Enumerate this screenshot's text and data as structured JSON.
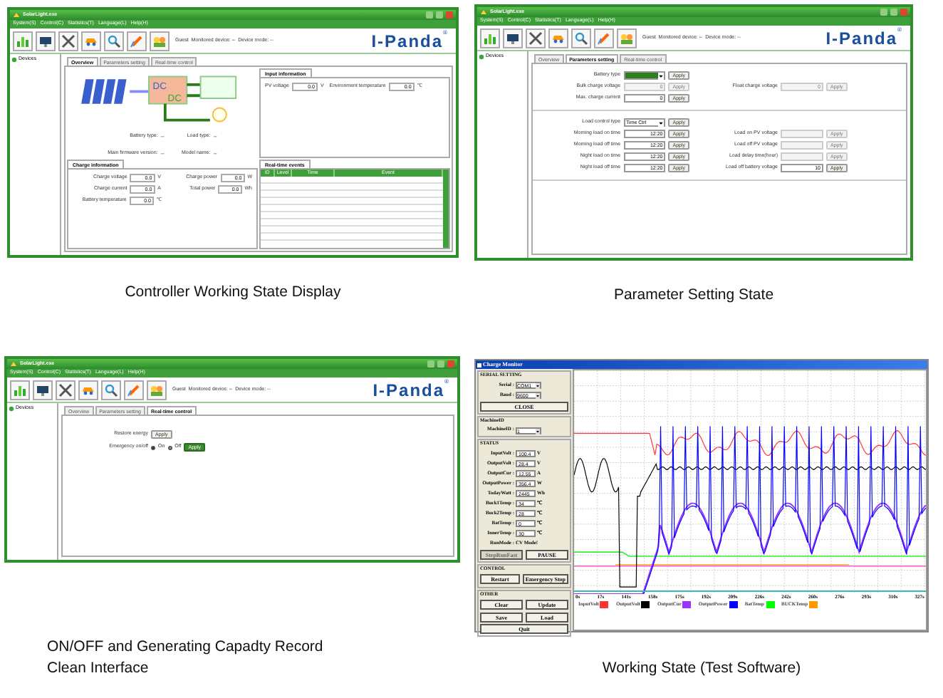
{
  "windows": [
    {
      "kind": "overview",
      "title": "SolarLight.exe",
      "menu": [
        "System(S)",
        "Control(C)",
        "Statistics(T)",
        "Language(L)",
        "Help(H)"
      ],
      "status": "Guest  Monitored device: --  Device mode: --",
      "logo": "I-Panda",
      "logo_mark": "®",
      "tree_item": "Devices",
      "tabs": [
        {
          "label": "Overview",
          "selected": true
        },
        {
          "label": "Parameters setting",
          "selected": false
        },
        {
          "label": "Real-time control",
          "selected": false
        }
      ],
      "diagram_labels": [
        "DC",
        "DC"
      ],
      "info": [
        {
          "label": "Battery type:",
          "value": "--"
        },
        {
          "label": "Load type:",
          "value": "--"
        },
        {
          "label": "Main firmware version:",
          "value": "--"
        },
        {
          "label": "Model name:",
          "value": "--"
        }
      ],
      "input_title": "Input information",
      "input_fields": [
        {
          "label": "PV voltage",
          "value": "0.0",
          "unit": "V"
        },
        {
          "label": "Environment temperature",
          "value": "0.0",
          "unit": "℃"
        }
      ],
      "charge_title": "Charge information",
      "charge_fields": [
        {
          "label": "Charge voltage",
          "value": "0.0",
          "unit": "V"
        },
        {
          "label": "Charge power",
          "value": "0.0",
          "unit": "W"
        },
        {
          "label": "Charge current",
          "value": "0.0",
          "unit": "A"
        },
        {
          "label": "Total power",
          "value": "0.0",
          "unit": "Wh"
        },
        {
          "label": "Battery temperature",
          "value": "0.0",
          "unit": "℃"
        }
      ],
      "events_title": "Real-time events",
      "events_columns": [
        "ID",
        "Level",
        "Time",
        "Event"
      ]
    },
    {
      "kind": "params",
      "title": "SolarLight.exe",
      "menu": [
        "System(S)",
        "Control(C)",
        "Statistics(T)",
        "Language(L)",
        "Help(H)"
      ],
      "status": "Guest  Monitored device: --  Device mode: --",
      "logo": "I-Panda",
      "logo_mark": "®",
      "tree_item": "Devices",
      "tabs": [
        {
          "label": "Overview",
          "selected": false
        },
        {
          "label": "Parameters setting",
          "selected": true
        },
        {
          "label": "Real-time control",
          "selected": false
        }
      ],
      "sections": [
        {
          "rows": [
            {
              "left": {
                "kind": "select",
                "label": "Battery type",
                "focused": true,
                "disabled": false,
                "button": "Apply"
              }
            },
            {
              "left": {
                "kind": "spin",
                "label": "Bulk charge voltage",
                "value": "0",
                "disabled": true,
                "button": "Apply"
              },
              "right": {
                "kind": "spin",
                "label": "Float charge voltage",
                "value": "0",
                "disabled": true,
                "button": "Apply"
              }
            },
            {
              "left": {
                "kind": "spin",
                "label": "Max. charge current",
                "value": "0",
                "disabled": false,
                "button": "Apply"
              }
            }
          ]
        },
        {
          "rows": [
            {
              "left": {
                "kind": "select",
                "label": "Load control type",
                "value": "Time Ctrl",
                "focused": false,
                "disabled": false,
                "button": "Apply"
              }
            },
            {
              "left": {
                "kind": "spin",
                "label": "Morning load on time",
                "value": "12:20",
                "disabled": false,
                "button": "Apply"
              },
              "right": {
                "kind": "spin",
                "label": "Load on PV voltage",
                "disabled": true,
                "button": "Apply"
              }
            },
            {
              "left": {
                "kind": "spin",
                "label": "Morning load off time",
                "value": "12:20",
                "disabled": false,
                "button": "Apply"
              },
              "right": {
                "kind": "spin",
                "label": "Load off PV voltage",
                "disabled": true,
                "button": "Apply"
              }
            },
            {
              "left": {
                "kind": "spin",
                "label": "Night load on time",
                "value": "12:20",
                "disabled": false,
                "button": "Apply"
              },
              "right": {
                "kind": "spin",
                "label": "Load delay time(hour)",
                "disabled": true,
                "button": "Apply"
              }
            },
            {
              "left": {
                "kind": "spin",
                "label": "Night load off time",
                "value": "12:20",
                "disabled": false,
                "button": "Apply"
              },
              "right": {
                "kind": "spin",
                "label": "Load off battery voltage",
                "value": "10",
                "disabled": false,
                "button": "Apply"
              }
            }
          ]
        }
      ]
    },
    {
      "kind": "control",
      "title": "SolarLight.exe",
      "menu": [
        "System(S)",
        "Control(C)",
        "Statistics(T)",
        "Language(L)",
        "Help(H)"
      ],
      "status": "Guest  Monitored device: --  Device mode: --",
      "logo": "I-Panda",
      "logo_mark": "®",
      "tree_item": "Devices",
      "tabs": [
        {
          "label": "Overview",
          "selected": false
        },
        {
          "label": "Parameters setting",
          "selected": false
        },
        {
          "label": "Real-time control",
          "selected": true
        }
      ],
      "rows": [
        {
          "kind": "button",
          "label": "Restore energy",
          "button": "Apply",
          "focused": false
        },
        {
          "kind": "radio",
          "label": "Emergency on/off",
          "options": [
            {
              "label": "On",
              "selected": true
            },
            {
              "label": "Off",
              "selected": false
            }
          ],
          "button": "Apply",
          "focused": true
        }
      ]
    }
  ],
  "monitor": {
    "title": "Charge Monitor",
    "groups": [
      {
        "title": "SERIAL SETTING",
        "rows": [
          {
            "kind": "select",
            "label": "Serial :",
            "value": "COM1"
          },
          {
            "kind": "select",
            "label": "Baud :",
            "value": "9600"
          },
          {
            "kind": "buttons",
            "buttons": [
              {
                "label": "CLOSE",
                "disabled": false
              }
            ]
          }
        ]
      },
      {
        "title": "MachineID",
        "rows": [
          {
            "kind": "select",
            "label": "MachineID :",
            "value": "1"
          }
        ]
      },
      {
        "title": "STATUS",
        "rows": [
          {
            "kind": "field",
            "label": "InputVolt :",
            "value": "100.4",
            "unit": "V"
          },
          {
            "kind": "field",
            "label": "OutputVolt :",
            "value": "28.4",
            "unit": "V"
          },
          {
            "kind": "field",
            "label": "OutputCur :",
            "value": "12.55",
            "unit": "A"
          },
          {
            "kind": "field",
            "label": "OutputPower :",
            "value": "356.4",
            "unit": "W"
          },
          {
            "kind": "field",
            "label": "TodayWatt :",
            "value": "2445",
            "unit": "Wh"
          },
          {
            "kind": "field",
            "label": "Buck1Temp :",
            "value": "34",
            "unit": "℃"
          },
          {
            "kind": "field",
            "label": "Buck2Temp :",
            "value": "28",
            "unit": "℃"
          },
          {
            "kind": "field",
            "label": "BatTemp :",
            "value": "0",
            "unit": "℃"
          },
          {
            "kind": "field",
            "label": "InnerTemp :",
            "value": "30",
            "unit": "℃"
          },
          {
            "kind": "text",
            "label": "RunMode :",
            "value": "CV Mode!"
          },
          {
            "kind": "buttons",
            "buttons": [
              {
                "label": "StepRunFast",
                "disabled": true
              },
              {
                "label": "PAUSE",
                "disabled": false
              }
            ]
          }
        ]
      },
      {
        "title": "CONTROL",
        "rows": [
          {
            "kind": "buttons",
            "buttons": [
              {
                "label": "Restart",
                "disabled": false
              },
              {
                "label": "Emergency Stop",
                "disabled": false
              }
            ]
          }
        ]
      },
      {
        "title": "OTHER",
        "rows": [
          {
            "kind": "buttons",
            "buttons": [
              {
                "label": "Clear",
                "disabled": false
              },
              {
                "label": "Update",
                "disabled": false
              }
            ]
          },
          {
            "kind": "buttons",
            "buttons": [
              {
                "label": "Save",
                "disabled": false
              },
              {
                "label": "Load",
                "disabled": false
              }
            ]
          },
          {
            "kind": "buttons",
            "buttons": [
              {
                "label": "Quit",
                "disabled": false
              }
            ]
          }
        ]
      }
    ],
    "x_labels": [
      "0s",
      "17s",
      "141s",
      "158s",
      "175s",
      "192s",
      "209s",
      "226s",
      "242s",
      "260s",
      "276s",
      "293s",
      "310s",
      "327s"
    ],
    "legend": [
      {
        "label": "InputVolt",
        "color": "#ff3333"
      },
      {
        "label": "OutputVolt",
        "color": "#000000"
      },
      {
        "label": "OutputCur",
        "color": "#9933ff"
      },
      {
        "label": "OutputPower",
        "color": "#0000ff"
      },
      {
        "label": "BatTemp",
        "color": "#00ff00"
      },
      {
        "label": "BUCKTemp",
        "color": "#ff9900"
      }
    ]
  },
  "captions": [
    "Controller Working State Display",
    "Parameter Setting State",
    "ON/OFF and Generating Capadty Record Clean Interface",
    "Working State (Test Software)"
  ]
}
